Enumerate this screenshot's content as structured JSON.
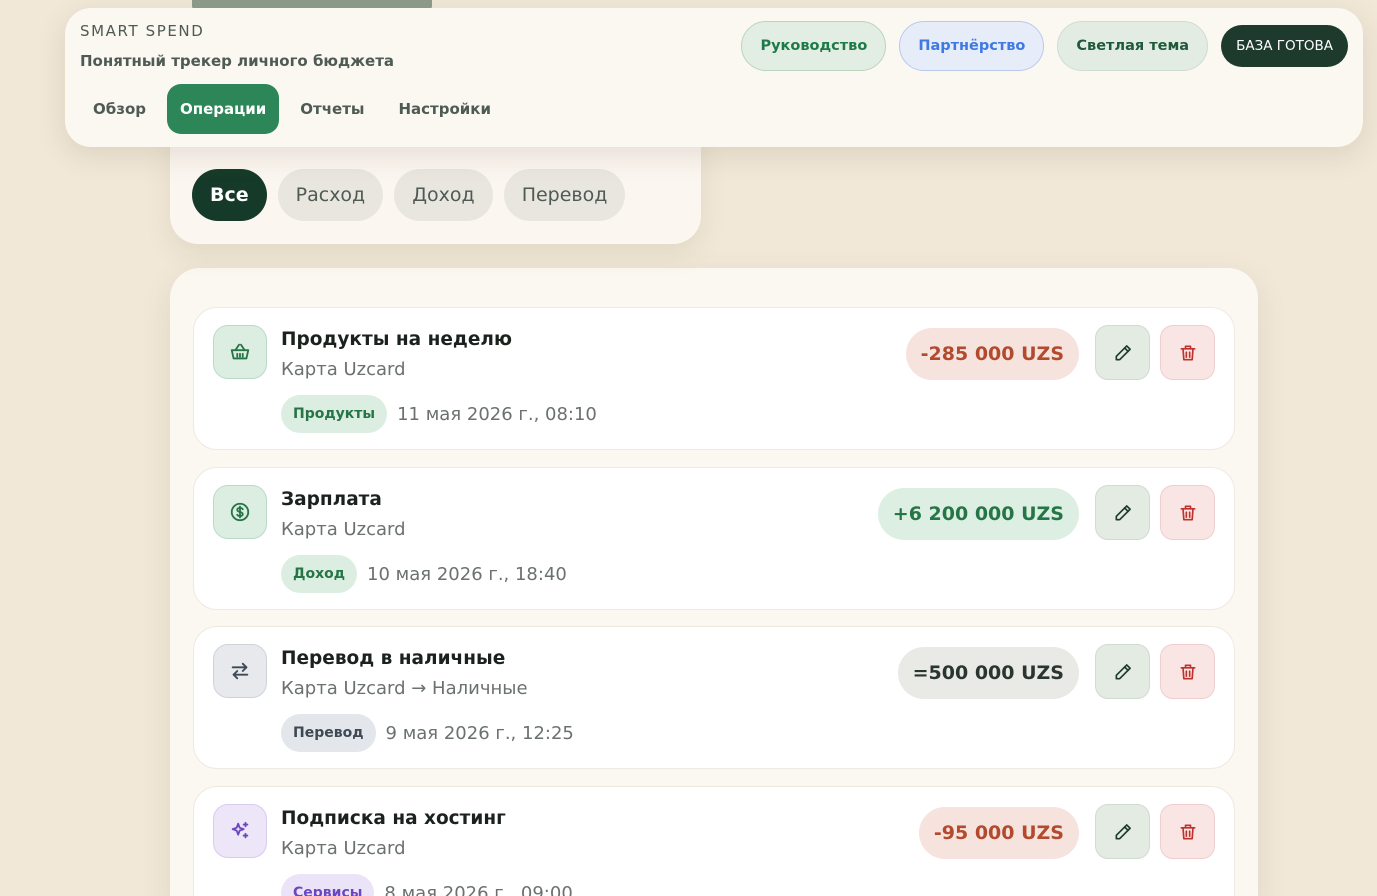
{
  "header": {
    "brand": "SMART SPEND",
    "subtitle": "Понятный трекер личного бюджета",
    "nav": [
      {
        "label": "Обзор",
        "active": false
      },
      {
        "label": "Операции",
        "active": true
      },
      {
        "label": "Отчеты",
        "active": false
      },
      {
        "label": "Настройки",
        "active": false
      }
    ],
    "actions": {
      "guide": "Руководство",
      "partner": "Партнёрство",
      "theme": "Светлая тема",
      "status": "БАЗА ГОТОВА"
    }
  },
  "filters": [
    {
      "label": "Все",
      "active": true
    },
    {
      "label": "Расход",
      "active": false
    },
    {
      "label": "Доход",
      "active": false
    },
    {
      "label": "Перевод",
      "active": false
    }
  ],
  "transactions": [
    {
      "icon": "basket-icon",
      "title": "Продукты на неделю",
      "account": "Карта Uzcard",
      "tag": "Продукты",
      "date": "11 мая 2026 г., 08:10",
      "amount": "-285 000 UZS",
      "kind": "expense"
    },
    {
      "icon": "dollar-circle-icon",
      "title": "Зарплата",
      "account": "Карта Uzcard",
      "tag": "Доход",
      "date": "10 мая 2026 г., 18:40",
      "amount": "+6 200 000 UZS",
      "kind": "income"
    },
    {
      "icon": "transfer-arrows-icon",
      "title": "Перевод в наличные",
      "account": "Карта Uzcard → Наличные",
      "tag": "Перевод",
      "date": "9 мая 2026 г., 12:25",
      "amount": "=500 000 UZS",
      "kind": "transfer"
    },
    {
      "icon": "sparkles-icon",
      "title": "Подписка на хостинг",
      "account": "Карта Uzcard",
      "tag": "Сервисы",
      "date": "8 мая 2026 г., 09:00",
      "amount": "-95 000 UZS",
      "kind": "expense"
    }
  ],
  "colors": {
    "accent": "#2c8657",
    "dark": "#163a29",
    "expense": "#b24a2e",
    "income": "#267547",
    "danger": "#c0312b"
  }
}
